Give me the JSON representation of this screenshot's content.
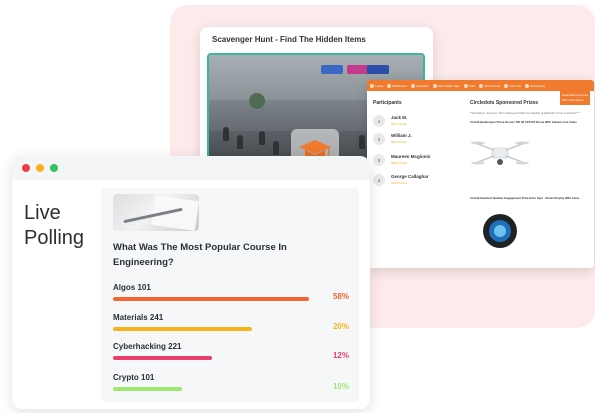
{
  "scavenger": {
    "title": "Scavenger Hunt - Find The Hidden Items",
    "accent": "#3bb79b"
  },
  "participants_window": {
    "header_color": "#f07a2e",
    "menu": [
      "Lobby",
      "Dashboard",
      "Uploaded",
      "Add A Mad Clips",
      "Polls",
      "Word Cloud",
      "Vote Poll",
      "Networking"
    ],
    "dropdown": [
      "Social Selfie And Image",
      "More Lobby Videos"
    ],
    "participants_title": "Participants",
    "participants": [
      {
        "rank": "1",
        "name": "Jack M.",
        "points": "9874 Points"
      },
      {
        "rank": "2",
        "name": "William J.",
        "points": "8431 Points"
      },
      {
        "rank": "3",
        "name": "Maureen Mcginnis",
        "points": "6859 Points"
      },
      {
        "rank": "4",
        "name": "George Callaghar",
        "points": "3010 Points"
      }
    ],
    "prizes_title": "Circledots Sponsored Prizes",
    "prizes_subtitle": "**Disclaimer: Premium Prize Delivered Within An Eligible Qualification Time Limit After***",
    "prizes": [
      {
        "name": "Circle8 Quadcopter Prime Drones TIR 4K FPS RX Drone With Camera Live Video",
        "icon": "drone-icon"
      },
      {
        "name": "Circle8 Smartest Number Engagement Prize Echo Spot - Smart Display With Alexa",
        "icon": "echo-spot-icon"
      }
    ]
  },
  "poll": {
    "heading": "Live Polling",
    "question": "What Was The Most Popular Course In Engineering?",
    "window_dots": [
      "#ee3d48",
      "#f6b417",
      "#36c25b"
    ],
    "options": [
      {
        "label": "Algos 101",
        "percent": "58%",
        "fill": 0.79,
        "color": "#f4652f"
      },
      {
        "label": "Materials 241",
        "percent": "20%",
        "fill": 0.56,
        "color": "#f8b21c"
      },
      {
        "label": "Cyberhacking 221",
        "percent": "12%",
        "fill": 0.4,
        "color": "#ea3f6b"
      },
      {
        "label": "Crypto 101",
        "percent": "10%",
        "fill": 0.28,
        "color": "#9ee86a"
      }
    ]
  }
}
